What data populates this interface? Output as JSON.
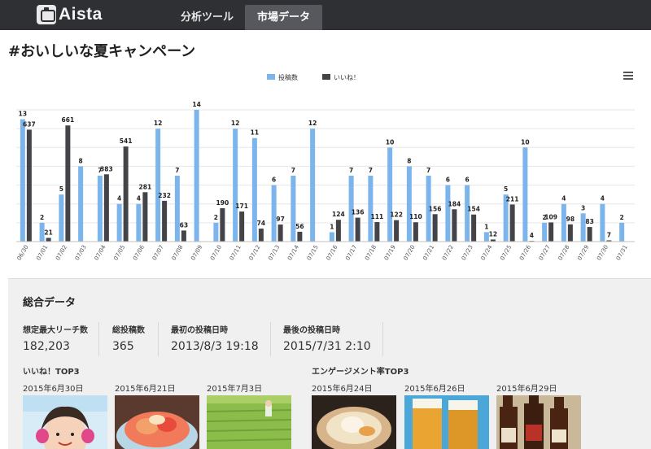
{
  "header": {
    "logo_text": "Aista",
    "tabs": [
      {
        "label": "分析ツール",
        "active": false
      },
      {
        "label": "市場データ",
        "active": true
      }
    ]
  },
  "page": {
    "title": "#おいしいな夏キャンペーン"
  },
  "chart_data": {
    "type": "bar",
    "categories": [
      "06/30",
      "07/01",
      "07/02",
      "07/03",
      "07/04",
      "07/05",
      "07/06",
      "07/07",
      "07/08",
      "07/09",
      "07/10",
      "07/11",
      "07/12",
      "07/13",
      "07/14",
      "07/15",
      "07/16",
      "07/17",
      "07/18",
      "07/19",
      "07/20",
      "07/21",
      "07/22",
      "07/23",
      "07/24",
      "07/25",
      "07/26",
      "07/27",
      "07/28",
      "07/29",
      "07/30",
      "07/31"
    ],
    "series": [
      {
        "name": "投稿数",
        "color": "#7cb5ec",
        "axis": "left",
        "values": [
          13,
          2,
          5,
          8,
          7,
          4,
          4,
          12,
          7,
          14,
          2,
          12,
          11,
          6,
          7,
          12,
          1,
          7,
          7,
          10,
          8,
          7,
          6,
          6,
          1,
          5,
          10,
          2,
          4,
          3,
          4,
          2
        ]
      },
      {
        "name": "いいね！",
        "color": "#434348",
        "axis": "right",
        "values": [
          637,
          21,
          661,
          null,
          383,
          541,
          281,
          232,
          63,
          null,
          190,
          171,
          74,
          97,
          56,
          null,
          124,
          136,
          111,
          122,
          110,
          156,
          184,
          154,
          12,
          211,
          4,
          109,
          98,
          83,
          7,
          null
        ]
      }
    ],
    "labels_series1": [
      "13",
      "2",
      "5",
      "8",
      "7",
      "4",
      "4",
      "12",
      "7",
      "14",
      "2",
      "12",
      "11",
      "6",
      "7",
      "12",
      "1",
      "7",
      "7",
      "10",
      "8",
      "7",
      "6",
      "6",
      "1",
      "5",
      "10",
      "2",
      "4",
      "3",
      "4",
      "2"
    ],
    "labels_series2": [
      "637",
      "21",
      "661",
      "",
      "383",
      "541",
      "281",
      "232",
      "63",
      "",
      "190",
      "171",
      "74",
      "97",
      "56",
      "",
      "124",
      "136",
      "111",
      "122",
      "110",
      "156",
      "184",
      "154",
      "12",
      "211",
      "4",
      "109",
      "98",
      "83",
      "7",
      ""
    ],
    "ylim_left": [
      0,
      14
    ],
    "ylim_right": [
      0,
      750
    ],
    "legend_position": "top-center",
    "grid": true
  },
  "summary": {
    "title": "総合データ",
    "stats": [
      {
        "label": "想定最大リーチ数",
        "value": "182,203"
      },
      {
        "label": "総投稿数",
        "value": "365"
      },
      {
        "label": "最初の投稿日時",
        "value": "2013/8/3 19:18"
      },
      {
        "label": "最後の投稿日時",
        "value": "2015/7/31 2:10"
      }
    ],
    "likes_top3": {
      "title": "いいね！TOP3",
      "items": [
        {
          "date": "2015年6月30日",
          "photo": "child-photo"
        },
        {
          "date": "2015年6月21日",
          "photo": "shaved-ice-photo"
        },
        {
          "date": "2015年7月3日",
          "photo": "rice-field-photo"
        }
      ]
    },
    "engagement_top3": {
      "title": "エンゲージメント率TOP3",
      "items": [
        {
          "date": "2015年6月24日",
          "photo": "scallop-photo"
        },
        {
          "date": "2015年6月26日",
          "photo": "beer-photo"
        },
        {
          "date": "2015年6月29日",
          "photo": "bottles-photo"
        }
      ]
    }
  }
}
